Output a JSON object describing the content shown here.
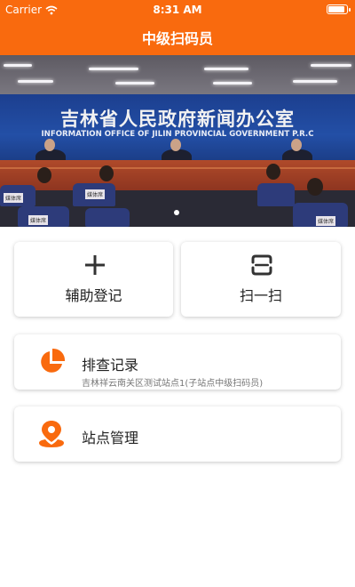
{
  "status_bar": {
    "carrier": "Carrier",
    "time": "8:31 AM"
  },
  "nav": {
    "title": "中级扫码员"
  },
  "banner": {
    "board_cn": "吉林省人民政府新闻办公室",
    "board_en": "INFORMATION OFFICE OF JILIN PROVINCIAL GOVERNMENT P.R.C",
    "signs": [
      "媒体席",
      "媒体席",
      "媒体席",
      "媒体席"
    ]
  },
  "actions": {
    "assist_register": {
      "label": "辅助登记",
      "icon": "plus-icon"
    },
    "scan": {
      "label": "扫一扫",
      "icon": "scan-icon"
    }
  },
  "cards": {
    "records": {
      "title": "排查记录",
      "subtitle": "吉林祥云南关区测试站点1(子站点中级扫码员)",
      "icon": "pie-chart-icon"
    },
    "site": {
      "title": "站点管理",
      "icon": "location-pin-icon"
    }
  },
  "colors": {
    "accent": "#f96a0e"
  }
}
